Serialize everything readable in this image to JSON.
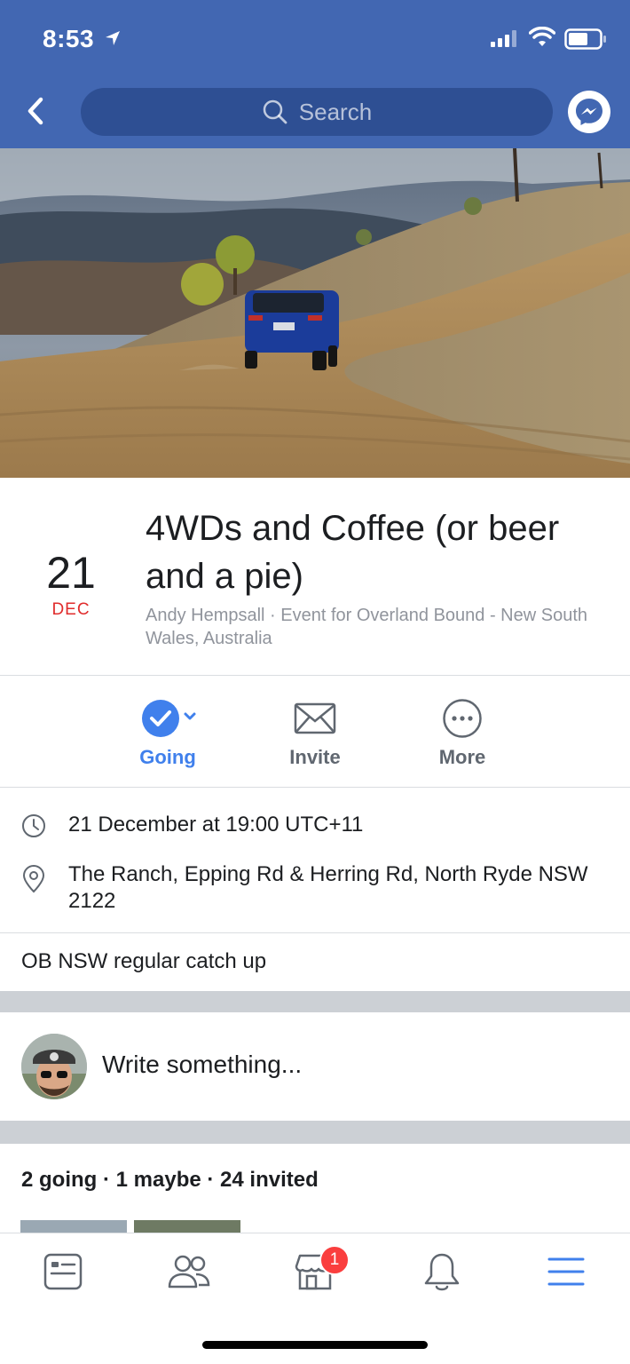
{
  "status_bar": {
    "time": "8:53"
  },
  "header": {
    "search_placeholder": "Search",
    "back_icon": "chevron-left-icon",
    "messenger_icon": "messenger-icon"
  },
  "event": {
    "day": "21",
    "month": "DEC",
    "title": "4WDs and Coffee (or beer and a pie)",
    "subtitle": "Andy Hempsall · Event for Overland Bound - New South Wales, Australia",
    "description": "OB NSW regular catch up"
  },
  "actions": [
    {
      "label": "Going",
      "icon": "check-circle-icon"
    },
    {
      "label": "Invite",
      "icon": "envelope-icon"
    },
    {
      "label": "More",
      "icon": "more-dots-icon"
    }
  ],
  "details": {
    "time": "21 December at 19:00 UTC+11",
    "location": "The Ranch, Epping Rd & Herring Rd, North Ryde NSW 2122"
  },
  "composer": {
    "placeholder": "Write something..."
  },
  "guests": {
    "summary": "2 going · 1 maybe · 24 invited"
  },
  "tabbar": {
    "items": [
      "news-feed-icon",
      "friends-icon",
      "marketplace-icon",
      "notifications-icon",
      "menu-icon"
    ],
    "marketplace_badge": "1"
  },
  "colors": {
    "brand": "#4267b2",
    "accent": "#4080ec",
    "date_red": "#e02c2c",
    "badge": "#fa3e3e"
  }
}
